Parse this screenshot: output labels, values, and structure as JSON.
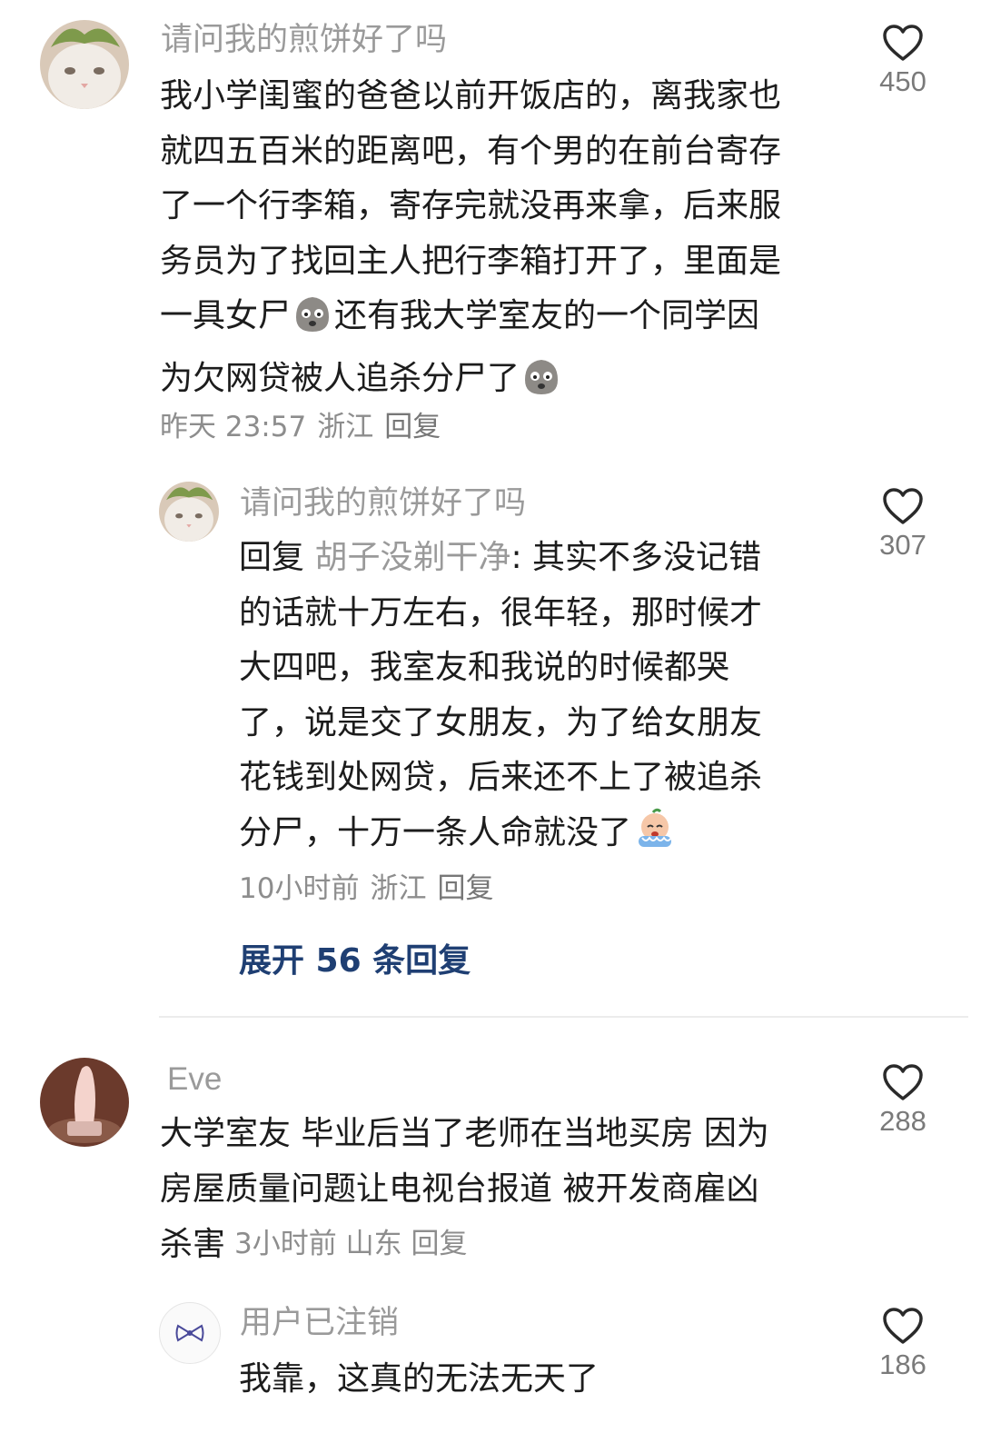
{
  "comments": [
    {
      "username": "请问我的煎饼好了吗",
      "text_lines": [
        "我小学闺蜜的爸爸以前开饭店的，离我家也",
        "就四五百米的距离吧，有个男的在前台寄存",
        "了一个行李箱，寄存完就没再来拿，后来服",
        "务员为了找回主人把行李箱打开了，里面是"
      ],
      "line5_a": "一具女尸",
      "line5_b": "还有我大学室友的一个同学因",
      "line6": "为欠网贷被人追杀分尸了",
      "time": "昨天 23:57",
      "location": "浙江",
      "reply_label": "回复",
      "likes": "450",
      "avatar_icon": "cat-avatar-icon",
      "reply": {
        "username": "请问我的煎饼好了吗",
        "prefix": "回复",
        "mention": "胡子没剃干净",
        "first_line_rest": ": 其实不多没记错",
        "text_lines": [
          "的话就十万左右，很年轻，那时候才",
          "大四吧，我室友和我说的时候都哭",
          "了，说是交了女朋友，为了给女朋友",
          "花钱到处网贷，后来还不上了被追杀"
        ],
        "last_line": "分尸，十万一条人命就没了",
        "time": "10小时前",
        "location": "浙江",
        "reply_label": "回复",
        "likes": "307"
      },
      "expand_label": "展开 56 条回复"
    },
    {
      "username": "Eve",
      "text_lines": [
        "大学室友 毕业后当了老师在当地买房 因为",
        "房屋质量问题让电视台报道 被开发商雇凶"
      ],
      "last_line": "杀害",
      "time": "3小时前",
      "location": "山东",
      "reply_label": "回复",
      "likes": "288",
      "reply": {
        "username": "用户已注销",
        "text": "我靠，这真的无法无天了",
        "likes": "186"
      }
    }
  ],
  "colors": {
    "username": "#9a9a9a",
    "expand": "#1f3f73",
    "meta": "#8d8d8d"
  }
}
